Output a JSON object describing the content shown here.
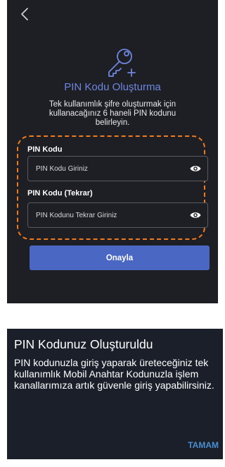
{
  "colors": {
    "screen_bg": "#1e1f24",
    "accent": "#6f86df",
    "highlight_outline": "#f07a1e",
    "primary_button": "#4a67c4",
    "dialog_bg": "#1a1f2a",
    "dialog_action": "#4a8ed0"
  },
  "header": {
    "back_icon": "chevron-left-icon"
  },
  "form": {
    "icon": "key-plus-icon",
    "title": "PIN Kodu Oluşturma",
    "subtitle": "Tek kullanımlık şifre oluşturmak için kullanacağınız 6 haneli PIN kodunu belirleyin.",
    "pin_label": "PIN Kodu",
    "pin_placeholder": "PIN Kodu Giriniz",
    "pin_value": "",
    "pin_repeat_label": "PIN Kodu (Tekrar)",
    "pin_repeat_placeholder": "PIN Kodunu Tekrar Giriniz",
    "pin_repeat_value": "",
    "visibility_icon": "eye-icon",
    "confirm_label": "Onayla"
  },
  "dialog": {
    "title": "PIN Kodunuz Oluşturuldu",
    "message": "PIN kodunuzla giriş yaparak üreteceğiniz tek kullanımlık Mobil Anahtar Kodunuzla işlem kanallarımıza artık güvenle giriş yapabilirsiniz.",
    "ok_label": "TAMAM"
  }
}
